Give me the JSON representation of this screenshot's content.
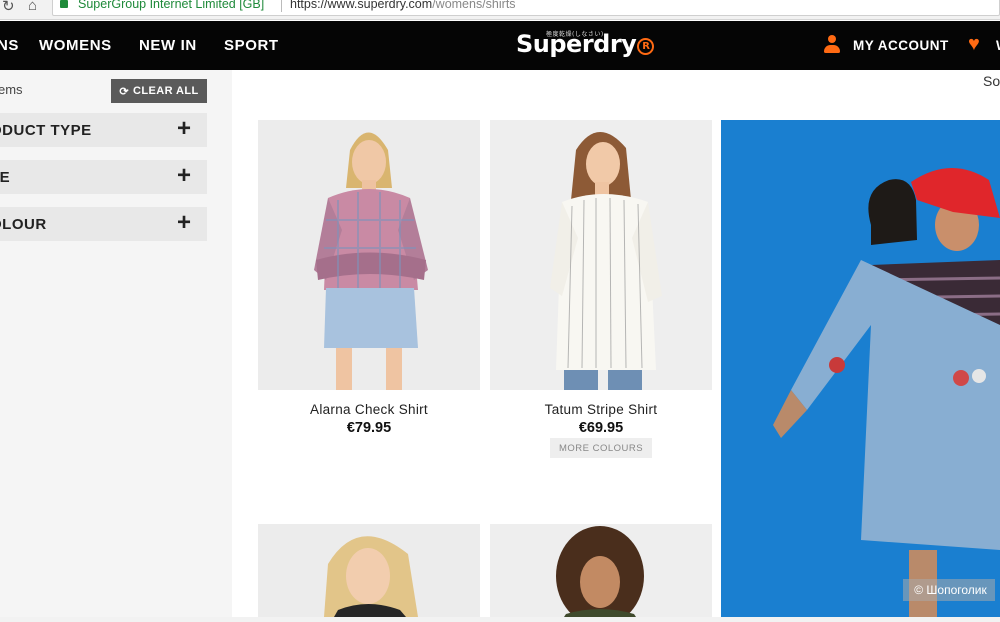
{
  "browser": {
    "cert_label": "SuperGroup Internet Limited [GB]",
    "url_main": "https://www.superdry.com",
    "url_path": "/womens/shirts"
  },
  "nav": {
    "links": [
      "NS",
      "WOMENS",
      "NEW IN",
      "SPORT"
    ],
    "logo": "Superdry",
    "logo_mark": "R",
    "logo_small": "極度乾燥(しなさい)",
    "account_label": "MY ACCOUNT",
    "wishlist_label": "W"
  },
  "filters": {
    "items_label": "ems",
    "clear_label": "CLEAR ALL",
    "groups": [
      "ODUCT TYPE",
      "ZE",
      "OLOUR"
    ]
  },
  "sort_label": "So",
  "products": [
    {
      "name": "Alarna Check Shirt",
      "price": "€79.95"
    },
    {
      "name": "Tatum Stripe Shirt",
      "price": "€69.95",
      "more_colours": "MORE COLOURS"
    }
  ],
  "watermark": "© Шопоголик",
  "colors": {
    "accent": "#ff6a13",
    "nav_bg": "#050505",
    "banner_bg": "#1a7fd0",
    "cert_green": "#1f8a3a"
  },
  "icons": [
    "reload-icon",
    "home-icon",
    "lock-icon",
    "account-icon",
    "heart-icon",
    "refresh-icon",
    "plus-icon",
    "camera-icon"
  ]
}
